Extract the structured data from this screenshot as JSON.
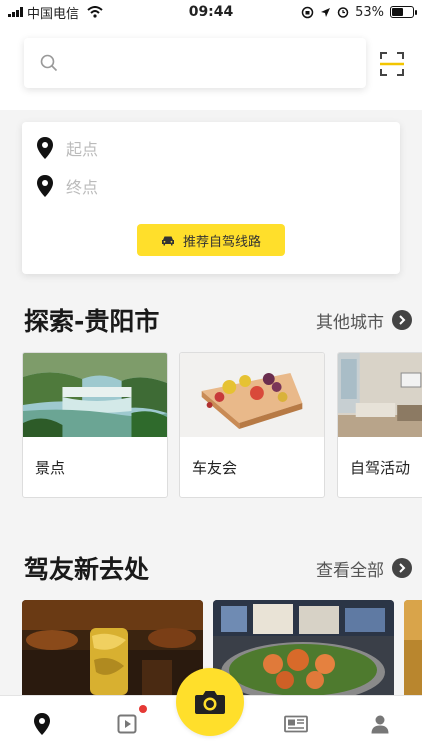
{
  "status_bar": {
    "carrier": "中国电信",
    "time": "09:44",
    "battery": "53%",
    "battery_level": 0.53
  },
  "search": {
    "placeholder": ""
  },
  "route": {
    "start_placeholder": "起点",
    "end_placeholder": "终点",
    "button_label": "推荐自驾线路"
  },
  "explore": {
    "title": "探索-贵阳市",
    "more_label": "其他城市",
    "cards": [
      {
        "label": "景点",
        "image": "waterfall-photo"
      },
      {
        "label": "车友会",
        "image": "fruit-tart-drawing"
      },
      {
        "label": "自驾活动",
        "image": "room-interior-photo"
      }
    ]
  },
  "new_places": {
    "title": "驾友新去处",
    "more_label": "查看全部"
  },
  "tabs": [
    {
      "name": "map",
      "icon": "location-pin-icon",
      "active": true
    },
    {
      "name": "video",
      "icon": "play-icon",
      "badge": true
    },
    {
      "name": "camera",
      "icon": "camera-icon"
    },
    {
      "name": "news",
      "icon": "newspaper-icon"
    },
    {
      "name": "profile",
      "icon": "user-icon"
    }
  ],
  "colors": {
    "accent": "#ffdf2b",
    "badge": "#e53935"
  }
}
